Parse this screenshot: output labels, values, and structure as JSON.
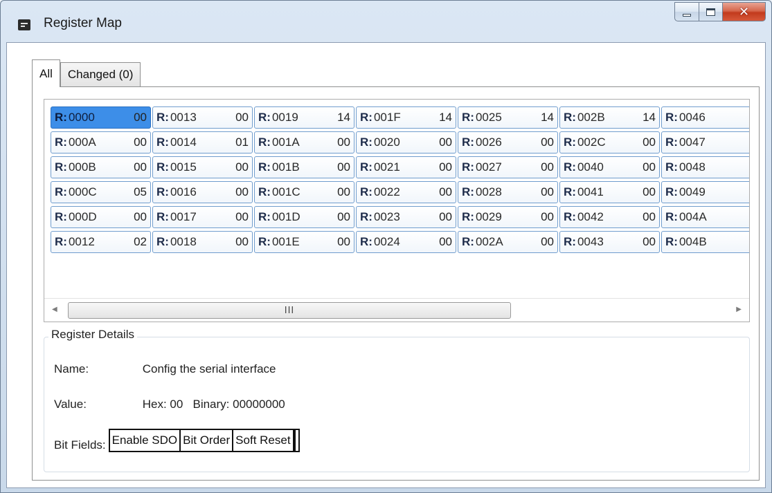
{
  "window": {
    "title": "Register Map",
    "icon": "register-map-app-icon",
    "controls": {
      "minimize": "minimize-icon",
      "maximize": "maximize-icon",
      "close": "close-icon"
    }
  },
  "tabs": [
    {
      "label": "All",
      "active": true
    },
    {
      "label": "Changed (0)",
      "active": false
    }
  ],
  "registers": [
    {
      "prefix": "R:",
      "addr": "0000",
      "value": "00",
      "selected": true
    },
    {
      "prefix": "R:",
      "addr": "000A",
      "value": "00"
    },
    {
      "prefix": "R:",
      "addr": "000B",
      "value": "00"
    },
    {
      "prefix": "R:",
      "addr": "000C",
      "value": "05"
    },
    {
      "prefix": "R:",
      "addr": "000D",
      "value": "00"
    },
    {
      "prefix": "R:",
      "addr": "0012",
      "value": "02"
    },
    {
      "prefix": "R:",
      "addr": "0013",
      "value": "00"
    },
    {
      "prefix": "R:",
      "addr": "0014",
      "value": "01"
    },
    {
      "prefix": "R:",
      "addr": "0015",
      "value": "00"
    },
    {
      "prefix": "R:",
      "addr": "0016",
      "value": "00"
    },
    {
      "prefix": "R:",
      "addr": "0017",
      "value": "00"
    },
    {
      "prefix": "R:",
      "addr": "0018",
      "value": "00"
    },
    {
      "prefix": "R:",
      "addr": "0019",
      "value": "14"
    },
    {
      "prefix": "R:",
      "addr": "001A",
      "value": "00"
    },
    {
      "prefix": "R:",
      "addr": "001B",
      "value": "00"
    },
    {
      "prefix": "R:",
      "addr": "001C",
      "value": "00"
    },
    {
      "prefix": "R:",
      "addr": "001D",
      "value": "00"
    },
    {
      "prefix": "R:",
      "addr": "001E",
      "value": "00"
    },
    {
      "prefix": "R:",
      "addr": "001F",
      "value": "14"
    },
    {
      "prefix": "R:",
      "addr": "0020",
      "value": "00"
    },
    {
      "prefix": "R:",
      "addr": "0021",
      "value": "00"
    },
    {
      "prefix": "R:",
      "addr": "0022",
      "value": "00"
    },
    {
      "prefix": "R:",
      "addr": "0023",
      "value": "00"
    },
    {
      "prefix": "R:",
      "addr": "0024",
      "value": "00"
    },
    {
      "prefix": "R:",
      "addr": "0025",
      "value": "14"
    },
    {
      "prefix": "R:",
      "addr": "0026",
      "value": "00"
    },
    {
      "prefix": "R:",
      "addr": "0027",
      "value": "00"
    },
    {
      "prefix": "R:",
      "addr": "0028",
      "value": "00"
    },
    {
      "prefix": "R:",
      "addr": "0029",
      "value": "00"
    },
    {
      "prefix": "R:",
      "addr": "002A",
      "value": "00"
    },
    {
      "prefix": "R:",
      "addr": "002B",
      "value": "14"
    },
    {
      "prefix": "R:",
      "addr": "002C",
      "value": "00"
    },
    {
      "prefix": "R:",
      "addr": "0040",
      "value": "00"
    },
    {
      "prefix": "R:",
      "addr": "0041",
      "value": "00"
    },
    {
      "prefix": "R:",
      "addr": "0042",
      "value": "00"
    },
    {
      "prefix": "R:",
      "addr": "0043",
      "value": "00"
    },
    {
      "prefix": "R:",
      "addr": "0046",
      "value": ""
    },
    {
      "prefix": "R:",
      "addr": "0047",
      "value": ""
    },
    {
      "prefix": "R:",
      "addr": "0048",
      "value": ""
    },
    {
      "prefix": "R:",
      "addr": "0049",
      "value": ""
    },
    {
      "prefix": "R:",
      "addr": "004A",
      "value": ""
    },
    {
      "prefix": "R:",
      "addr": "004B",
      "value": ""
    }
  ],
  "scrollbar": {
    "thumb_grip": "III"
  },
  "details": {
    "legend": "Register Details",
    "name_label": "Name:",
    "name_value": "Config the serial interface",
    "value_label": "Value:",
    "value_text": "Hex: 00   Binary: 00000000",
    "bitfields_label": "Bit Fields:",
    "bitfields": [
      "Enable SDO",
      "Bit Order",
      "Soft Reset"
    ]
  },
  "colors": {
    "selected_cell": "#3d8ee8",
    "cell_border": "#6f9ccd",
    "close_button": "#c23b1d"
  }
}
